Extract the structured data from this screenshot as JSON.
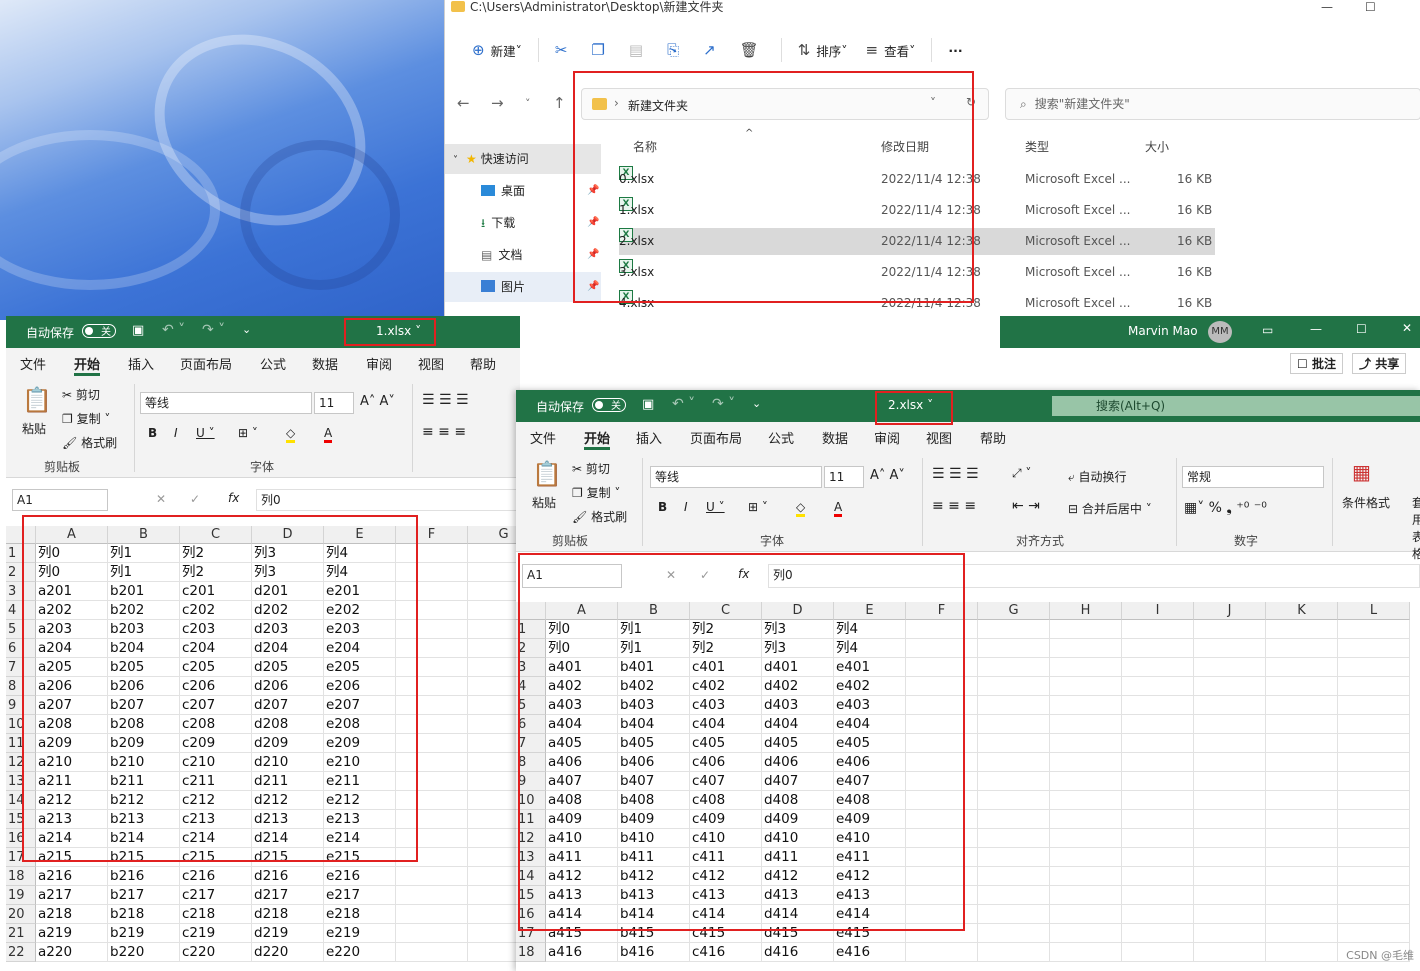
{
  "explorer": {
    "title": "C:\\Users\\Administrator\\Desktop\\新建文件夹",
    "toolbar": {
      "new": "新建",
      "sort": "排序",
      "view": "查看",
      "more": "···"
    },
    "path_folder": "新建文件夹",
    "search_placeholder": "搜索\"新建文件夹\"",
    "sidebar": [
      {
        "label": "快速访问"
      },
      {
        "label": "桌面"
      },
      {
        "label": "下载"
      },
      {
        "label": "文档"
      },
      {
        "label": "图片"
      }
    ],
    "columns": {
      "name": "名称",
      "modified": "修改日期",
      "type": "类型",
      "size": "大小"
    },
    "files": [
      {
        "name": "0.xlsx",
        "modified": "2022/11/4 12:38",
        "type": "Microsoft Excel ...",
        "size": "16 KB"
      },
      {
        "name": "1.xlsx",
        "modified": "2022/11/4 12:38",
        "type": "Microsoft Excel ...",
        "size": "16 KB"
      },
      {
        "name": "2.xlsx",
        "modified": "2022/11/4 12:38",
        "type": "Microsoft Excel ...",
        "size": "16 KB"
      },
      {
        "name": "3.xlsx",
        "modified": "2022/11/4 12:38",
        "type": "Microsoft Excel ...",
        "size": "16 KB"
      },
      {
        "name": "4.xlsx",
        "modified": "2022/11/4 12:38",
        "type": "Microsoft Excel ...",
        "size": "16 KB"
      }
    ]
  },
  "excel_common": {
    "autosave": "自动保存",
    "toggle": "关",
    "search": "搜索(Alt+Q)",
    "tabs": [
      "文件",
      "开始",
      "插入",
      "页面布局",
      "公式",
      "数据",
      "审阅",
      "视图",
      "帮助"
    ],
    "ribbon": {
      "paste": "粘贴",
      "cut": "剪切",
      "copy": "复制",
      "format_painter": "格式刷",
      "clipboard": "剪贴板",
      "font_name": "等线",
      "font_size": "11",
      "font_group": "字体",
      "wrap": "自动换行",
      "merge": "合并后居中",
      "align_group": "对齐方式",
      "number_format": "常规",
      "number_group": "数字",
      "cond_format": "条件格式",
      "table_fmt": "套用表格",
      "comment": "批注",
      "share": "共享"
    },
    "cell_ref": "A1",
    "formula": "列0",
    "fx": "fx",
    "user": "Marvin Mao",
    "initials": "MM"
  },
  "excel1": {
    "filename": "1.xlsx",
    "columns": [
      "A",
      "B",
      "C",
      "D",
      "E",
      "F",
      "G"
    ],
    "rows": [
      [
        "列0",
        "列1",
        "列2",
        "列3",
        "列4"
      ],
      [
        "列0",
        "列1",
        "列2",
        "列3",
        "列4"
      ],
      [
        "a201",
        "b201",
        "c201",
        "d201",
        "e201"
      ],
      [
        "a202",
        "b202",
        "c202",
        "d202",
        "e202"
      ],
      [
        "a203",
        "b203",
        "c203",
        "d203",
        "e203"
      ],
      [
        "a204",
        "b204",
        "c204",
        "d204",
        "e204"
      ],
      [
        "a205",
        "b205",
        "c205",
        "d205",
        "e205"
      ],
      [
        "a206",
        "b206",
        "c206",
        "d206",
        "e206"
      ],
      [
        "a207",
        "b207",
        "c207",
        "d207",
        "e207"
      ],
      [
        "a208",
        "b208",
        "c208",
        "d208",
        "e208"
      ],
      [
        "a209",
        "b209",
        "c209",
        "d209",
        "e209"
      ],
      [
        "a210",
        "b210",
        "c210",
        "d210",
        "e210"
      ],
      [
        "a211",
        "b211",
        "c211",
        "d211",
        "e211"
      ],
      [
        "a212",
        "b212",
        "c212",
        "d212",
        "e212"
      ],
      [
        "a213",
        "b213",
        "c213",
        "d213",
        "e213"
      ],
      [
        "a214",
        "b214",
        "c214",
        "d214",
        "e214"
      ],
      [
        "a215",
        "b215",
        "c215",
        "d215",
        "e215"
      ],
      [
        "a216",
        "b216",
        "c216",
        "d216",
        "e216"
      ],
      [
        "a217",
        "b217",
        "c217",
        "d217",
        "e217"
      ],
      [
        "a218",
        "b218",
        "c218",
        "d218",
        "e218"
      ],
      [
        "a219",
        "b219",
        "c219",
        "d219",
        "e219"
      ],
      [
        "a220",
        "b220",
        "c220",
        "d220",
        "e220"
      ]
    ]
  },
  "excel2": {
    "filename": "2.xlsx",
    "columns": [
      "A",
      "B",
      "C",
      "D",
      "E",
      "F",
      "G",
      "H",
      "I",
      "J",
      "K",
      "L"
    ],
    "rows": [
      [
        "列0",
        "列1",
        "列2",
        "列3",
        "列4"
      ],
      [
        "列0",
        "列1",
        "列2",
        "列3",
        "列4"
      ],
      [
        "a401",
        "b401",
        "c401",
        "d401",
        "e401"
      ],
      [
        "a402",
        "b402",
        "c402",
        "d402",
        "e402"
      ],
      [
        "a403",
        "b403",
        "c403",
        "d403",
        "e403"
      ],
      [
        "a404",
        "b404",
        "c404",
        "d404",
        "e404"
      ],
      [
        "a405",
        "b405",
        "c405",
        "d405",
        "e405"
      ],
      [
        "a406",
        "b406",
        "c406",
        "d406",
        "e406"
      ],
      [
        "a407",
        "b407",
        "c407",
        "d407",
        "e407"
      ],
      [
        "a408",
        "b408",
        "c408",
        "d408",
        "e408"
      ],
      [
        "a409",
        "b409",
        "c409",
        "d409",
        "e409"
      ],
      [
        "a410",
        "b410",
        "c410",
        "d410",
        "e410"
      ],
      [
        "a411",
        "b411",
        "c411",
        "d411",
        "e411"
      ],
      [
        "a412",
        "b412",
        "c412",
        "d412",
        "e412"
      ],
      [
        "a413",
        "b413",
        "c413",
        "d413",
        "e413"
      ],
      [
        "a414",
        "b414",
        "c414",
        "d414",
        "e414"
      ],
      [
        "a415",
        "b415",
        "c415",
        "d415",
        "e415"
      ],
      [
        "a416",
        "b416",
        "c416",
        "d416",
        "e416"
      ]
    ]
  },
  "watermark": "CSDN @毛维",
  "colors": {
    "excel_green": "#217346",
    "highlight_red": "#e12020"
  }
}
